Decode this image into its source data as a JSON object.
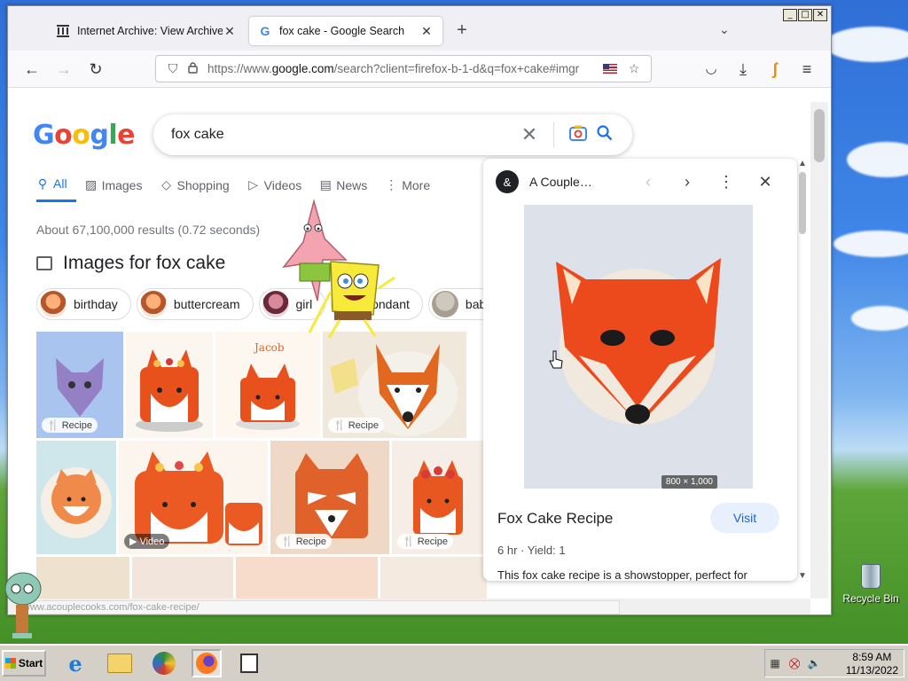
{
  "window": {
    "tabs": [
      {
        "title": "Internet Archive: View Archive",
        "favicon": "archive-icon",
        "active": false
      },
      {
        "title": "fox cake - Google Search",
        "favicon": "google-g-icon",
        "active": true
      }
    ],
    "url_prefix": "https://www.",
    "url_domain": "google.com",
    "url_rest": "/search?client=firefox-b-1-d&q=fox+cake#imgr"
  },
  "google": {
    "query": "fox cake",
    "tabs": [
      "All",
      "Images",
      "Shopping",
      "Videos",
      "News",
      "More"
    ],
    "result_stats": "About 67,100,000 results (0.72 seconds)",
    "images_heading": "Images for fox cake",
    "chips": [
      "birthday",
      "buttercream",
      "girl",
      "fondant",
      "baby"
    ],
    "badges": {
      "recipe": "Recipe",
      "video": "Video"
    }
  },
  "panel": {
    "source": "A Couple…",
    "dimensions": "800 × 1,000",
    "title": "Fox Cake Recipe",
    "visit": "Visit",
    "time": "6 hr",
    "yield": "Yield: 1",
    "description": "This fox cake recipe is a showstopper, perfect for"
  },
  "status_url": "www.acouplecooks.com/fox-cake-recipe/",
  "desktop": {
    "recycle_bin": "Recycle Bin"
  },
  "taskbar": {
    "start": "Start",
    "time": "8:59 AM",
    "date": "11/13/2022"
  },
  "colors": {
    "google_blue": "#1a73e8",
    "fox_orange": "#e8501c",
    "taskbar": "#d4d0c8"
  }
}
